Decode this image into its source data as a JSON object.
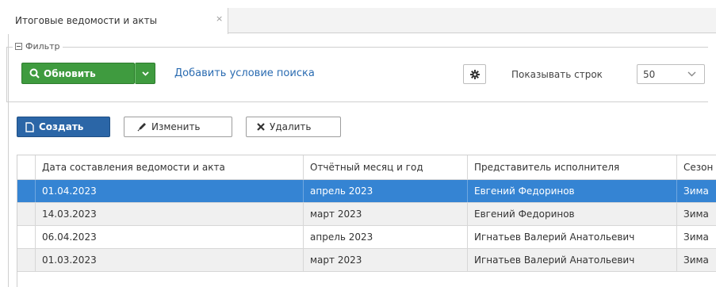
{
  "tab": {
    "title": "Итоговые ведомости и акты",
    "close": "×"
  },
  "filter": {
    "legend": "Фильтр",
    "refresh_label": "Обновить",
    "add_condition": "Добавить условие поиска",
    "rows_label": "Показывать строк",
    "rows_value": "50"
  },
  "toolbar": {
    "create_label": "Создать",
    "edit_label": "Изменить",
    "delete_label": "Удалить"
  },
  "table": {
    "columns": [
      "Дата составления ведомости и акта",
      "Отчётный месяц и год",
      "Представитель исполнителя",
      "Сезон"
    ],
    "rows": [
      [
        "01.04.2023",
        "апрель 2023",
        "Евгений Федоринов",
        "Зима"
      ],
      [
        "14.03.2023",
        "март 2023",
        "Евгений Федоринов",
        "Зима"
      ],
      [
        "06.04.2023",
        "апрель 2023",
        "Игнатьев Валерий Анатольевич",
        "Зима"
      ],
      [
        "01.03.2023",
        "март 2023",
        "Игнатьев Валерий Анатольевич",
        "Зима"
      ]
    ],
    "selected_row": 0
  },
  "colors": {
    "green": "#3f9b3f",
    "blue": "#2b66a7",
    "selected": "#3584d3",
    "link": "#2a6bb1"
  },
  "icons": [
    "search-icon",
    "chevron-down-icon",
    "gear-icon",
    "document-icon",
    "pencil-icon",
    "cross-icon",
    "collapse-icon"
  ]
}
